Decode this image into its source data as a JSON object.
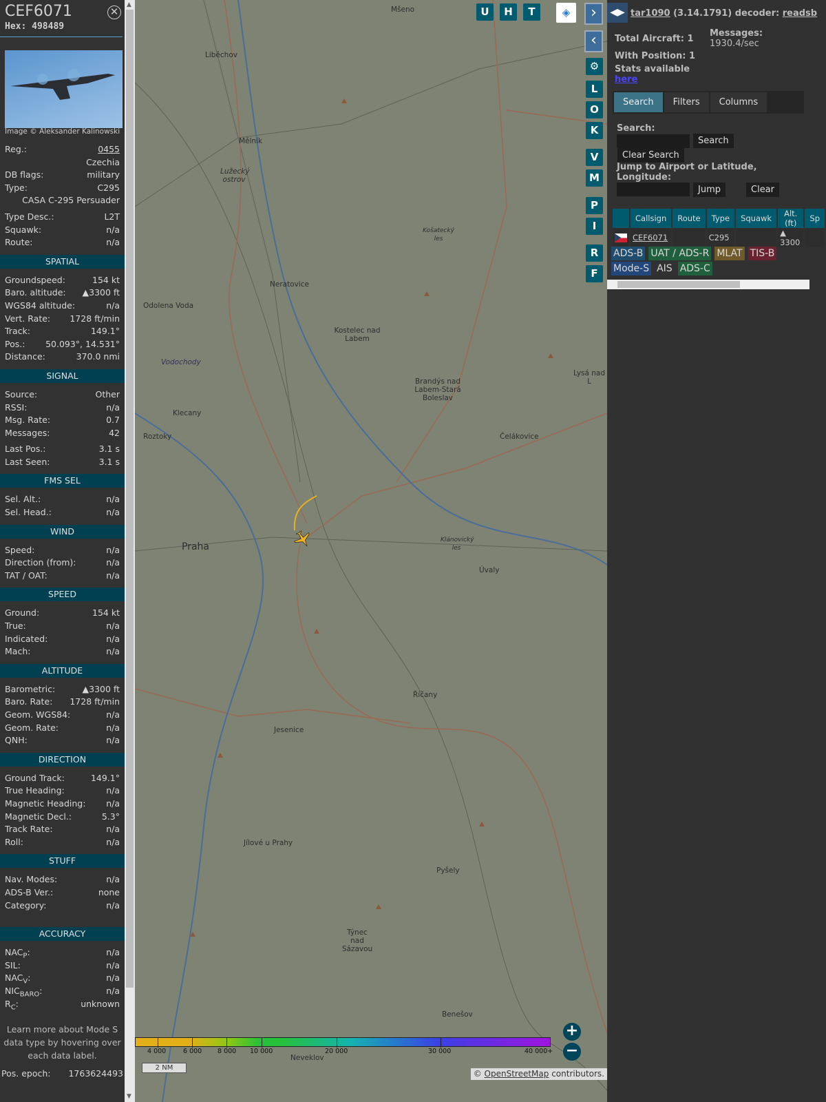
{
  "selected": {
    "callsign": "CEF6071",
    "hex_label": "Hex:",
    "hex": "498489",
    "close_icon": "circle-x",
    "photo_credit": "Image © Aleksander Kalinowski",
    "top_rows": [
      {
        "label": "Reg.:",
        "value": "0455",
        "link": true
      },
      {
        "label": "",
        "value": "Czechia"
      },
      {
        "label": "DB flags:",
        "value": "military"
      },
      {
        "label": "Type:",
        "value": "C295"
      },
      {
        "label": "",
        "value": "CASA C-295 Persuader"
      },
      {
        "label": "Type Desc.:",
        "value": "L2T"
      },
      {
        "label": "Squawk:",
        "value": "n/a"
      },
      {
        "label": "Route:",
        "value": "n/a"
      }
    ],
    "sections": [
      {
        "title": "SPATIAL",
        "rows": [
          {
            "label": "Groundspeed:",
            "value": "154 kt"
          },
          {
            "label": "Baro. altitude:",
            "value": "▲3300 ft"
          },
          {
            "label": "WGS84 altitude:",
            "value": "n/a"
          },
          {
            "label": "Vert. Rate:",
            "value": "1728 ft/min"
          },
          {
            "label": "Track:",
            "value": "149.1°"
          },
          {
            "label": "Pos.:",
            "value": "50.093°, 14.531°"
          },
          {
            "label": "Distance:",
            "value": "370.0 nmi"
          }
        ]
      },
      {
        "title": "SIGNAL",
        "rows": [
          {
            "label": "Source:",
            "value": "Other"
          },
          {
            "label": "RSSI:",
            "value": "n/a"
          },
          {
            "label": "Msg. Rate:",
            "value": "0.7"
          },
          {
            "label": "Messages:",
            "value": "42"
          },
          {
            "label": "Last Pos.:",
            "value": "3.1 s",
            "gap": true
          },
          {
            "label": "Last Seen:",
            "value": "3.1 s"
          }
        ]
      },
      {
        "title": "FMS SEL",
        "rows": [
          {
            "label": "Sel. Alt.:",
            "value": "n/a"
          },
          {
            "label": "Sel. Head.:",
            "value": "n/a"
          }
        ]
      },
      {
        "title": "WIND",
        "rows": [
          {
            "label": "Speed:",
            "value": "n/a"
          },
          {
            "label": "Direction (from):",
            "value": "n/a"
          },
          {
            "label": "TAT / OAT:",
            "value": "n/a"
          }
        ]
      },
      {
        "title": "SPEED",
        "rows": [
          {
            "label": "Ground:",
            "value": "154 kt"
          },
          {
            "label": "True:",
            "value": "n/a"
          },
          {
            "label": "Indicated:",
            "value": "n/a"
          },
          {
            "label": "Mach:",
            "value": "n/a"
          }
        ]
      },
      {
        "title": "ALTITUDE",
        "rows": [
          {
            "label": "Barometric:",
            "value": "▲3300 ft"
          },
          {
            "label": "Baro. Rate:",
            "value": "1728 ft/min"
          },
          {
            "label": "Geom. WGS84:",
            "value": "n/a"
          },
          {
            "label": "Geom. Rate:",
            "value": "n/a"
          },
          {
            "label": "QNH:",
            "value": "n/a"
          }
        ]
      },
      {
        "title": "DIRECTION",
        "rows": [
          {
            "label": "Ground Track:",
            "value": "149.1°"
          },
          {
            "label": "True Heading:",
            "value": "n/a"
          },
          {
            "label": "Magnetic Heading:",
            "value": "n/a"
          },
          {
            "label": "Magnetic Decl.:",
            "value": "5.3°"
          },
          {
            "label": "Track Rate:",
            "value": "n/a"
          },
          {
            "label": "Roll:",
            "value": "n/a"
          }
        ]
      },
      {
        "title": "STUFF",
        "rows": [
          {
            "label": "Nav. Modes:",
            "value": "n/a"
          },
          {
            "label": "ADS-B Ver.:",
            "value": "none"
          },
          {
            "label": "Category:",
            "value": "n/a"
          }
        ]
      },
      {
        "title": "ACCURACY",
        "rows": [
          {
            "label": "NAC",
            "sub": "P",
            "label2": ":",
            "value": "n/a"
          },
          {
            "label": "SIL:",
            "value": "n/a"
          },
          {
            "label": "NAC",
            "sub": "V",
            "label2": ":",
            "value": "n/a"
          },
          {
            "label": "NIC",
            "sub": "BARO",
            "label2": ":",
            "value": "n/a"
          },
          {
            "label": "R",
            "sub": "C",
            "label2": ":",
            "value": "unknown"
          }
        ]
      }
    ],
    "note": "Learn more about Mode S data type by hovering over each data label.",
    "epoch_label": "Pos. epoch:",
    "epoch": "1763624493"
  },
  "map": {
    "buttons": [
      "U",
      "H",
      "T"
    ],
    "side_buttons": [
      "L",
      "O",
      "K",
      "V",
      "M",
      "P",
      "I",
      "R",
      "F"
    ],
    "labels": [
      "Mšeno",
      "Liběchov",
      "Mělník",
      "Lužecký ostrov",
      "Neratovice",
      "Kostelec nad Labem",
      "Odolena Voda",
      "Vodochody",
      "Brandýs nad Labem-Stará Boleslav",
      "Lysá nad L",
      "Klecany",
      "Roztoky",
      "Čelákovice",
      "Praha",
      "Úvaly",
      "Říčany",
      "Jesenice",
      "Jílové u Prahy",
      "Pyšely",
      "Týnec nad Sázavou",
      "Benešov",
      "Neveklov",
      "Košatecký les",
      "Klánovický les"
    ],
    "legend": [
      "4 000",
      "6 000",
      "8 000",
      "10 000",
      "20 000",
      "30 000",
      "40 000+"
    ],
    "scale": "2 NM",
    "attribution_prefix": "© ",
    "attribution_link": "OpenStreetMap",
    "attribution_suffix": " contributors."
  },
  "right": {
    "version_link": "tar1090",
    "version": " (3.14.1791) decoder: ",
    "decoder": "readsb",
    "total_aircraft": "Total Aircraft: 1",
    "with_position": "With Position: 1",
    "stats": "Stats available",
    "stats_link": "here",
    "messages_label": "Messages:",
    "messages": "1930.4/sec",
    "tabs": [
      "Search",
      "Filters",
      "Columns"
    ],
    "search_label": "Search:",
    "search_button": "Search",
    "clear_search": "Clear Search",
    "jump_label": "Jump to Airport or Latitude, Longitude:",
    "jump_button": "Jump",
    "clear_button": "Clear",
    "columns": [
      "Callsign",
      "Route",
      "Type",
      "Squawk",
      "Alt. (ft)",
      "Sp"
    ],
    "rows": [
      {
        "callsign": "CEF6071",
        "route": "",
        "type": "C295",
        "squawk": "",
        "alt": "▲  3300"
      }
    ],
    "badges": [
      {
        "label": "ADS-B",
        "color": "#1f4d6e"
      },
      {
        "label": "UAT / ADS-R",
        "color": "#21603c"
      },
      {
        "label": "MLAT",
        "color": "#6e5a2a"
      },
      {
        "label": "TIS-B",
        "color": "#6a2230"
      },
      {
        "label": "Mode-S",
        "color": "#23477a"
      },
      {
        "label": "AIS",
        "color": "#313131"
      },
      {
        "label": "ADS-C",
        "color": "#21603c"
      }
    ]
  }
}
